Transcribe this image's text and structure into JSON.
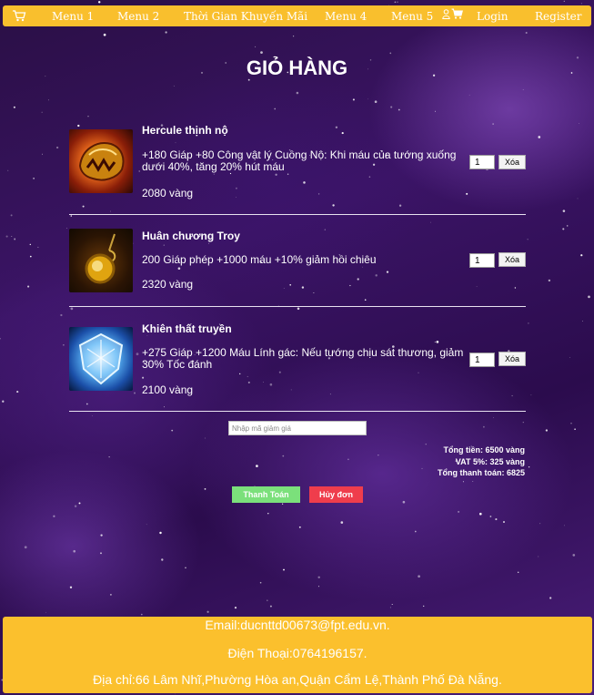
{
  "nav": {
    "items": [
      "Menu 1",
      "Menu 2",
      "Thời Gian Khuyến Mãi",
      "Menu 4",
      "Menu 5"
    ],
    "login": "Login",
    "register": "Register"
  },
  "page_title": "GIỎ HÀNG",
  "cart": {
    "items": [
      {
        "name": "Hercule thịnh nộ",
        "description": "+180 Giáp +80 Công vật lý Cuồng Nộ: Khi máu của tướng xuống dưới 40%, tăng 20% hút máu",
        "price": "2080 vàng",
        "quantity": "1",
        "delete_label": "Xóa",
        "icon": "hercule-fury-icon"
      },
      {
        "name": "Huân chương Troy",
        "description": "200 Giáp phép +1000 máu +10% giảm hồi chiêu",
        "price": "2320 vàng",
        "quantity": "1",
        "delete_label": "Xóa",
        "icon": "troy-medal-icon"
      },
      {
        "name": "Khiên thất truyền",
        "description": "+275 Giáp +1200 Máu Lính gác: Nếu tướng chịu sát thương, giảm 30% Tốc đánh",
        "price": "2100 vàng",
        "quantity": "1",
        "delete_label": "Xóa",
        "icon": "lost-shield-icon"
      }
    ],
    "coupon_placeholder": "Nhập mã giảm giá",
    "total": "Tổng tiền: 6500 vàng",
    "vat": "VAT 5%: 325 vàng",
    "grand_total": "Tổng thanh toán: 6825",
    "pay_label": "Thanh Toán",
    "cancel_label": "Hủy đơn"
  },
  "footer": {
    "email": "Email:ducnttd00673@fpt.edu.vn.",
    "phone": "Điện Thoại:0764196157.",
    "address": "Địa chỉ:66 Lâm Nhĩ,Phường Hòa an,Quận Cẩm Lệ,Thành Phố Đà Nẵng."
  },
  "colors": {
    "nav_bg": "#f9bf2d",
    "footer_bg": "#fbc02d",
    "pay_button": "#7be07b",
    "cancel_button": "#ef3d4c"
  }
}
